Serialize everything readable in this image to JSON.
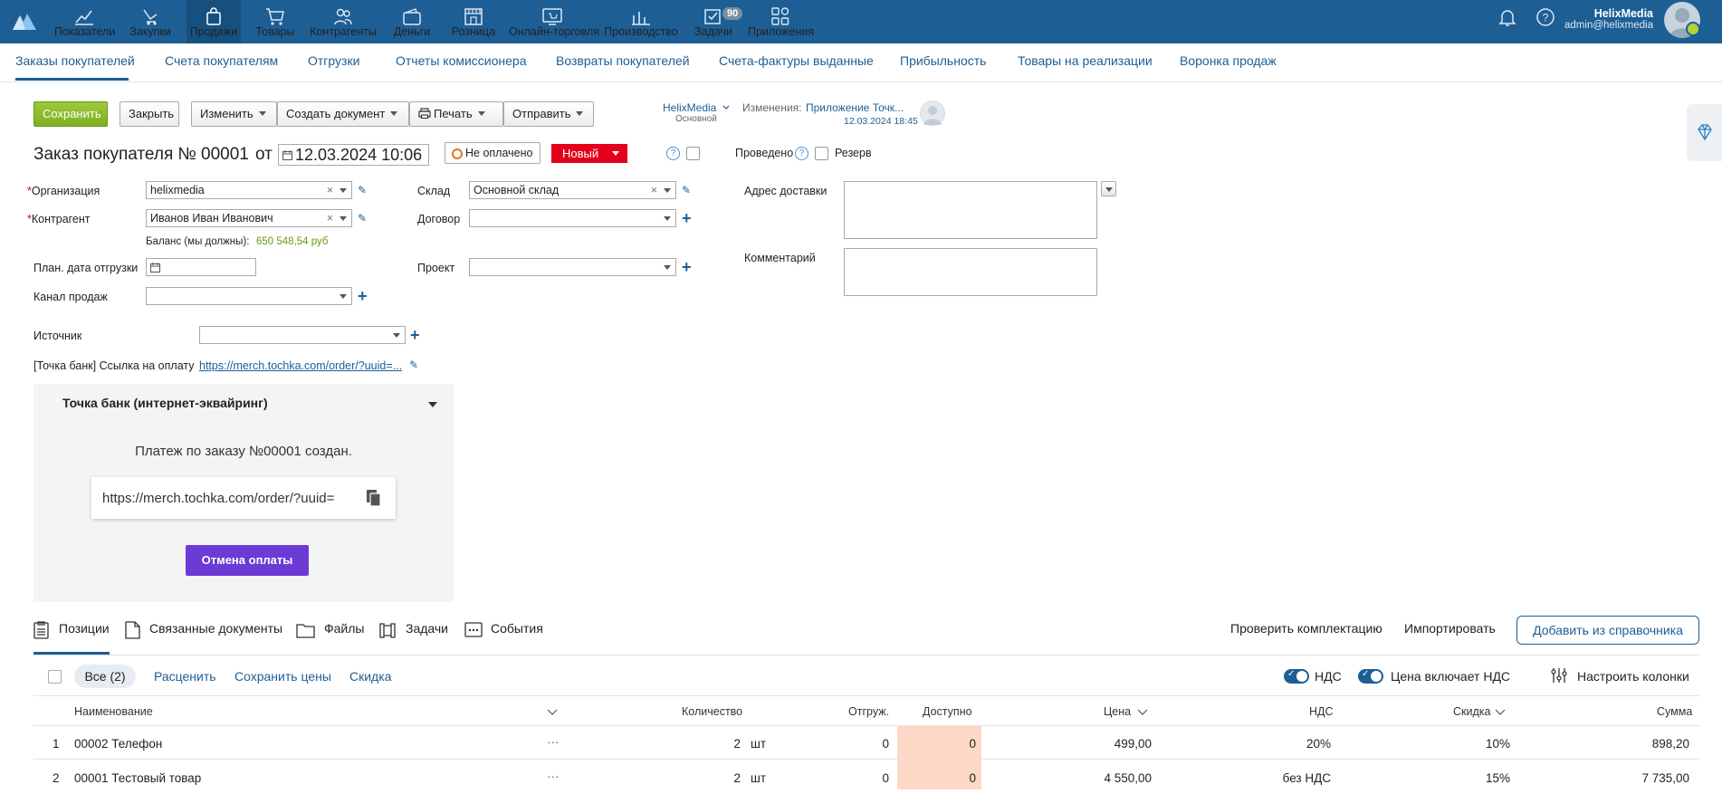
{
  "topbar": {
    "nav": [
      {
        "label": "Показатели",
        "icon": "chart-icon"
      },
      {
        "label": "Закупки",
        "icon": "basket-hand-icon"
      },
      {
        "label": "Продажи",
        "icon": "bag-icon"
      },
      {
        "label": "Товары",
        "icon": "cart-icon"
      },
      {
        "label": "Контрагенты",
        "icon": "people-icon"
      },
      {
        "label": "Деньги",
        "icon": "wallet-icon"
      },
      {
        "label": "Розница",
        "icon": "store-icon"
      },
      {
        "label": "Онлайн-торговля",
        "icon": "online-store-icon"
      },
      {
        "label": "Производство",
        "icon": "production-icon"
      },
      {
        "label": "Задачи",
        "icon": "tasks-icon"
      },
      {
        "label": "Приложения",
        "icon": "apps-icon"
      }
    ],
    "tasks_badge": "90",
    "user_name": "HelixMedia",
    "user_email": "admin@helixmedia"
  },
  "subnav": [
    "Заказы покупателей",
    "Счета покупателям",
    "Отгрузки",
    "Отчеты комиссионера",
    "Возвраты покупателей",
    "Счета-фактуры выданные",
    "Прибыльность",
    "Товары на реализации",
    "Воронка продаж"
  ],
  "toolbar": {
    "save": "Сохранить",
    "close": "Закрыть",
    "edit": "Изменить",
    "create_doc": "Создать документ",
    "print": "Печать",
    "send": "Отправить",
    "owner": "HelixMedia",
    "owner_sub": "Основной",
    "changes_label": "Изменения:",
    "changes_value": "Приложение Точк...",
    "changes_time": "12.03.2024 18:45"
  },
  "doc": {
    "title": "Заказ покупателя №",
    "number": "00001",
    "from": "от",
    "date": "12.03.2024 10:06",
    "paid_status": "Не оплачено",
    "status": "Новый",
    "help": "?",
    "posted": "Проведено",
    "reserve": "Резерв"
  },
  "form": {
    "org_label": "Организация",
    "org_value": "helixmedia",
    "counterparty_label": "Контрагент",
    "counterparty_value": "Иванов Иван Иванович",
    "balance_label": "Баланс (мы должны):",
    "balance_value": "650 548,54 руб",
    "ship_date_label": "План. дата отгрузки",
    "channel_label": "Канал продаж",
    "warehouse_label": "Склад",
    "warehouse_value": "Основной склад",
    "contract_label": "Договор",
    "project_label": "Проект",
    "address_label": "Адрес доставки",
    "comment_label": "Комментарий",
    "source_label": "Источник",
    "paylink_label": "[Точка банк] Ссылка на оплату",
    "paylink_value": "https://merch.tochka.com/order/?uuid=..."
  },
  "widget": {
    "title": "Точка банк (интернет-эквайринг)",
    "message": "Платеж по заказу №00001 создан.",
    "url": "https://merch.tochka.com/order/?uuid=",
    "cancel": "Отмена оплаты"
  },
  "tabs": {
    "items": [
      "Позиции",
      "Связанные документы",
      "Файлы",
      "Задачи",
      "События"
    ],
    "check": "Проверить комплектацию",
    "import": "Импортировать",
    "add": "Добавить из справочника"
  },
  "filters": {
    "all": "Все (2)",
    "reprice": "Расценить",
    "save_prices": "Сохранить цены",
    "discount": "Скидка",
    "vat": "НДС",
    "price_incl_vat": "Цена включает НДС",
    "columns": "Настроить колонки"
  },
  "table": {
    "headers": [
      "Наименование",
      "Количество",
      "Отгруж.",
      "Доступно",
      "Цена",
      "НДС",
      "Скидка",
      "Сумма"
    ],
    "rows": [
      {
        "n": "1",
        "name": "00002 Телефон",
        "dots": "···",
        "qty": "2",
        "unit": "шт",
        "shipped": "0",
        "avail": "0",
        "price": "499,00",
        "vat": "20%",
        "discount": "10%",
        "sum": "898,20"
      },
      {
        "n": "2",
        "name": "00001 Тестовый товар",
        "dots": "···",
        "qty": "2",
        "unit": "шт",
        "shipped": "0",
        "avail": "0",
        "price": "4 550,00",
        "vat": "без НДС",
        "discount": "15%",
        "sum": "7 735,00"
      }
    ]
  }
}
